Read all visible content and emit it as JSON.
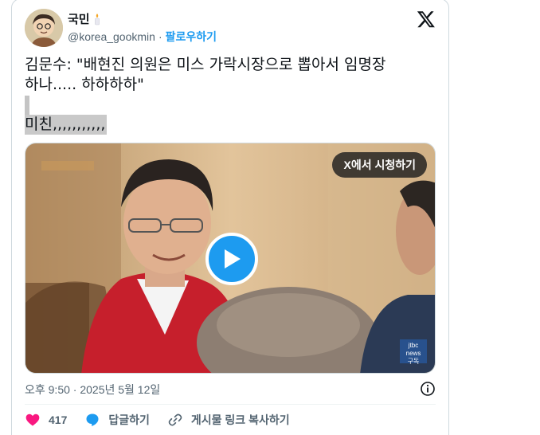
{
  "author": {
    "display_name": "국민",
    "handle": "@korea_gookmin",
    "separator": "·",
    "follow_label": "팔로우하기"
  },
  "tweet": {
    "line1": "김문수: \"배현진 의원은 미스 가락시장으로 뽑아서 임명장",
    "line2": "하나..... 하하하하\"",
    "line3": "미친,,,,,,,,,,,"
  },
  "media": {
    "watch_label": "X에서 시청하기",
    "badge_line1": "jtbc",
    "badge_line2": "news",
    "badge_line3": "구독"
  },
  "timestamp": "오후 9:50 · 2025년 5월 12일",
  "actions": {
    "like_count": "417",
    "reply_label": "답글하기",
    "copy_link_label": "게시물 링크 복사하기"
  },
  "colors": {
    "accent": "#1d9bf0",
    "like": "#f91880",
    "text": "#0f1419",
    "muted": "#536471"
  }
}
